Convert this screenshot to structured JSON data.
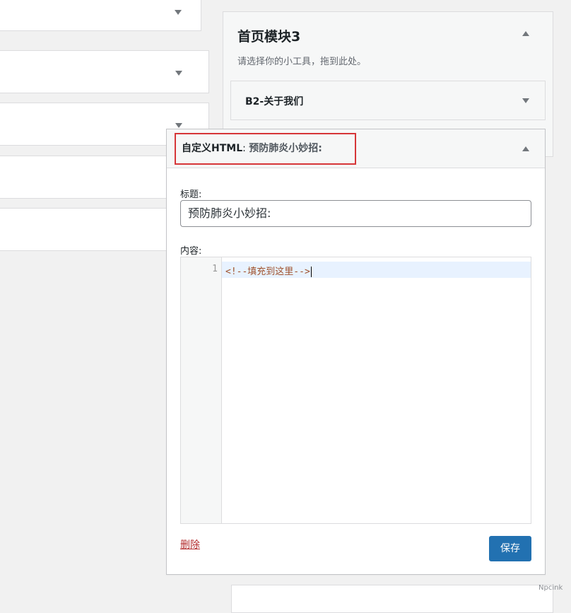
{
  "sidebar": {
    "title": "首页模块3",
    "description": "请选择你的小工具，拖到此处。",
    "collapse_icon": "arrow-up-icon"
  },
  "widgets": {
    "b2_about": {
      "title": "B2-关于我们",
      "toggle_icon": "arrow-down-icon"
    },
    "custom_html": {
      "type_label": "自定义HTML",
      "colon": ": ",
      "name_label": "预防肺炎小妙招:",
      "title_field_label": "标题:",
      "title_value": "预防肺炎小妙招:",
      "content_field_label": "内容:",
      "editor": {
        "line_number": "1",
        "code": "<!--填充到这里-->"
      },
      "delete_label": "删除",
      "save_label": "保存"
    }
  },
  "watermark": "Npcink",
  "colors": {
    "highlight": "#d63638",
    "primary_button": "#2271b1",
    "delete_link": "#b32d2e",
    "code_comment": "#a0522d"
  }
}
